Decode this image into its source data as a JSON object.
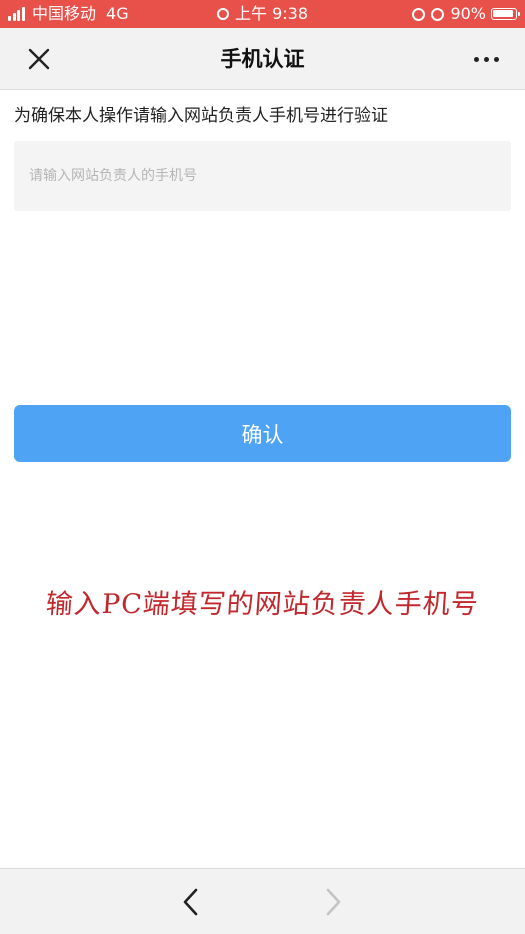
{
  "status_bar": {
    "carrier": "中国移动",
    "network": "4G",
    "time": "上午 9:38",
    "battery": "90%"
  },
  "nav": {
    "title": "手机认证"
  },
  "form": {
    "instruction": "为确保本人操作请输入网站负责人手机号进行验证",
    "phone_placeholder": "请输入网站负责人的手机号",
    "phone_value": "",
    "confirm_label": "确认"
  },
  "annotation": "输入PC端填写的网站负责人手机号",
  "colors": {
    "status_bar": "#e8504a",
    "primary_button": "#4ea3f5",
    "annotation_text": "#c0282d"
  },
  "icons": {
    "close": "close-icon",
    "more": "more-icon",
    "back": "chevron-left-icon",
    "forward": "chevron-right-icon"
  }
}
